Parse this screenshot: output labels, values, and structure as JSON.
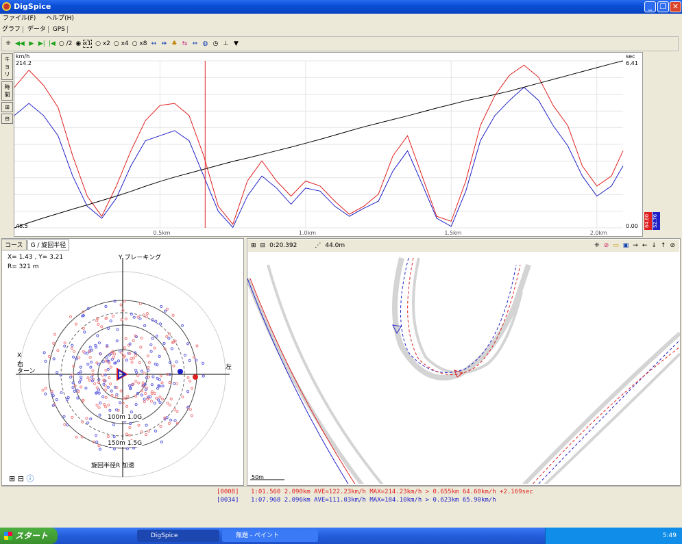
{
  "window": {
    "title": "DigSpice",
    "btn_min": "_",
    "btn_max": "❐",
    "btn_close": "✕"
  },
  "menu": {
    "file": "ファイル(F)",
    "help": "ヘルプ(H)"
  },
  "view_tabs": {
    "graph": "グラフ",
    "data": "データ",
    "gps": "GPS"
  },
  "toolbar": {
    "speed_half": "/2",
    "speed_x1": "x1",
    "speed_x2": "x2",
    "speed_x4": "x4",
    "speed_x8": "x8",
    "icons": [
      "reset-view-icon",
      "rewind-icon",
      "play-icon",
      "step-forward-icon",
      "step-back-icon"
    ]
  },
  "chart_data": {
    "type": "line",
    "x": [
      0.0,
      0.05,
      0.1,
      0.15,
      0.2,
      0.25,
      0.3,
      0.35,
      0.4,
      0.45,
      0.5,
      0.55,
      0.6,
      0.65,
      0.7,
      0.75,
      0.8,
      0.85,
      0.9,
      0.95,
      1.0,
      1.05,
      1.1,
      1.15,
      1.2,
      1.25,
      1.3,
      1.35,
      1.4,
      1.45,
      1.5,
      1.55,
      1.6,
      1.65,
      1.7,
      1.75,
      1.8,
      1.85,
      1.9,
      1.95,
      2.0,
      2.05,
      2.09
    ],
    "xlim": [
      0,
      2.09
    ],
    "xticks": [
      "0.5km",
      "1.0km",
      "1.5km",
      "2.0km"
    ],
    "ylabel_left": "km/h",
    "ylim_left": [
      48.5,
      214.2
    ],
    "ylabel_right": "sec",
    "ylim_right": [
      0.0,
      6.41
    ],
    "left_top": "214.2",
    "left_bottom": "48.5",
    "right_top": "6.41",
    "right_bottom": "0.00",
    "series": [
      {
        "color": "#e02020",
        "values": [
          188,
          205,
          190,
          168,
          120,
          80,
          60,
          90,
          125,
          155,
          170,
          172,
          160,
          120,
          70,
          52,
          95,
          115,
          95,
          80,
          95,
          90,
          75,
          62,
          70,
          82,
          120,
          140,
          100,
          60,
          55,
          95,
          150,
          180,
          200,
          210,
          198,
          170,
          150,
          110,
          90,
          100,
          125
        ]
      },
      {
        "color": "#2020c8",
        "values": [
          160,
          172,
          160,
          140,
          100,
          70,
          58,
          78,
          110,
          135,
          140,
          145,
          135,
          100,
          65,
          49,
          80,
          100,
          88,
          72,
          88,
          85,
          70,
          60,
          68,
          75,
          105,
          125,
          92,
          58,
          50,
          85,
          135,
          160,
          175,
          188,
          175,
          150,
          130,
          100,
          80,
          90,
          110
        ]
      },
      {
        "color": "#000000",
        "values": [
          0.0,
          0.2,
          0.38,
          0.55,
          0.72,
          0.88,
          1.05,
          1.22,
          1.4,
          1.6,
          1.78,
          1.95,
          2.1,
          2.25,
          2.4,
          2.55,
          2.68,
          2.82,
          2.96,
          3.1,
          3.25,
          3.4,
          3.56,
          3.72,
          3.88,
          4.02,
          4.16,
          4.3,
          4.45,
          4.6,
          4.74,
          4.88,
          5.0,
          5.12,
          5.25,
          5.4,
          5.55,
          5.7,
          5.85,
          6.0,
          6.15,
          6.3,
          6.41
        ]
      }
    ],
    "cursor_x": 0.655,
    "badges": {
      "red": "64.60",
      "blue": "52.76"
    }
  },
  "gpanel": {
    "tab_course": "コース",
    "tab_g": "G / 旋回半径",
    "xy_readout": "X=  1.43 ,  Y=  3.21",
    "r_readout": "R= 321 m",
    "label_top": "Y ブレーキング",
    "label_left_1": "X",
    "label_left_2": "右",
    "label_left_3": "ターン",
    "label_right": "左",
    "label_bottom": "旋回半径R  加速",
    "ring_100": "100m 1.0G",
    "ring_150": "150m 1.5G"
  },
  "course": {
    "zoom_time": "0:20.392",
    "distance": "44.0m",
    "scale": "50m"
  },
  "laps": [
    {
      "id": "[0008]",
      "text": "1:01.560 2.090km AVE=122.23km/h MAX=214.23km/h > 0.655km 64.60km/h +2.169sec",
      "color": "#e02020"
    },
    {
      "id": "[0034]",
      "text": "1:07.968 2.096km AVE=111.03km/h MAX=184.10km/h > 0.623km 65.90km/h",
      "color": "#2020c8"
    }
  ],
  "taskbar": {
    "start": "スタート",
    "task1": "DigSpice",
    "task2": "無題 - ペイント",
    "time": "5:49"
  }
}
